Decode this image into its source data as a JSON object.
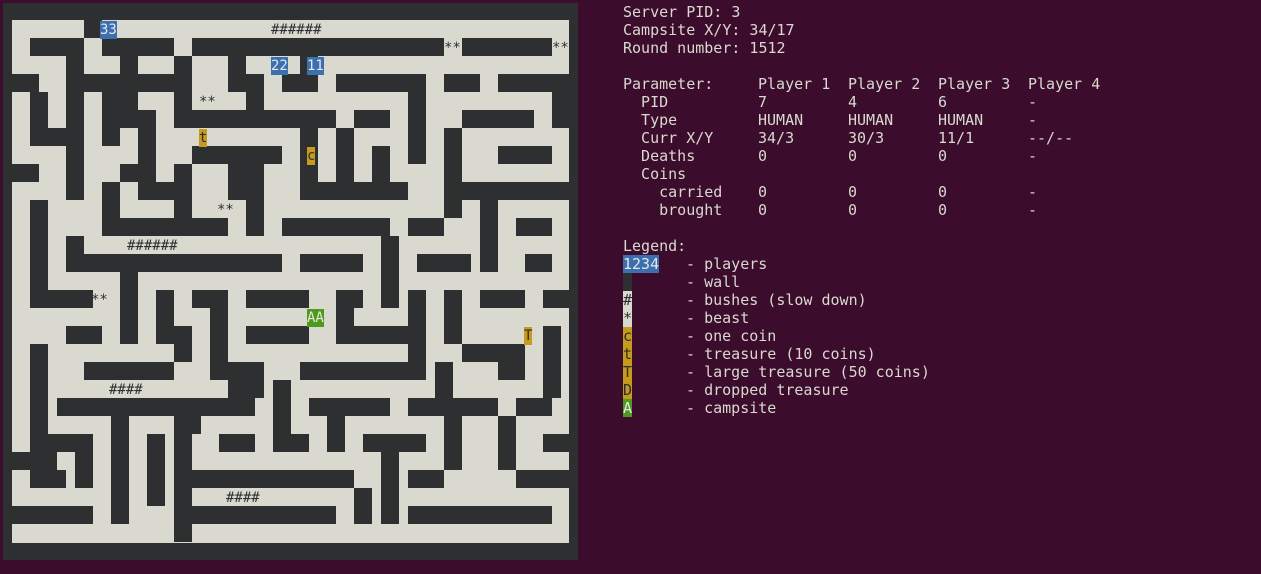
{
  "colors": {
    "background": "#3b0c2c",
    "wall": "#2d2f30",
    "floor": "#d9d9d0",
    "player": "#3b6fb0",
    "coin": "#c69a1a",
    "campsite": "#4f9a1d"
  },
  "header": {
    "server_pid": "Server PID: 3",
    "campsite_xy": "Campsite X/Y: 34/17",
    "round_number": "Round number: 1512"
  },
  "params": {
    "header": [
      "Parameter:",
      "Player 1",
      "Player 2",
      "Player 3",
      "Player 4"
    ],
    "rows": [
      {
        "label": "  PID",
        "values": [
          "7",
          "4",
          "6",
          "-"
        ]
      },
      {
        "label": "  Type",
        "values": [
          "HUMAN",
          "HUMAN",
          "HUMAN",
          "-"
        ]
      },
      {
        "label": "  Curr X/Y",
        "values": [
          "34/3",
          "30/3",
          "11/1",
          "--/--"
        ]
      },
      {
        "label": "  Deaths",
        "values": [
          "0",
          "0",
          "0",
          "-"
        ]
      },
      {
        "label": "  Coins",
        "values": [
          "",
          "",
          "",
          ""
        ]
      },
      {
        "label": "    carried",
        "values": [
          "0",
          "0",
          "0",
          "-"
        ]
      },
      {
        "label": "    brought",
        "values": [
          "0",
          "0",
          "0",
          "-"
        ]
      }
    ]
  },
  "legend": {
    "title": "Legend:",
    "items": [
      {
        "symbol": "1234",
        "kind": "players",
        "text": " - players"
      },
      {
        "symbol": " ",
        "kind": "wall",
        "text": " - wall"
      },
      {
        "symbol": "#",
        "kind": "bush",
        "text": " - bushes (slow down)"
      },
      {
        "symbol": "*",
        "kind": "beast",
        "text": " - beast"
      },
      {
        "symbol": "c",
        "kind": "coin",
        "text": " - one coin"
      },
      {
        "symbol": "t",
        "kind": "coin",
        "text": " - treasure (10 coins)"
      },
      {
        "symbol": "T",
        "kind": "coin",
        "text": " - large treasure (50 coins)"
      },
      {
        "symbol": "D",
        "kind": "coin",
        "text": " - dropped treasure"
      },
      {
        "symbol": "A",
        "kind": "camp",
        "text": " - campsite"
      }
    ]
  },
  "map": {
    "players": [
      "33",
      "22",
      "11"
    ],
    "campsite": "AA",
    "coins": [
      "t",
      "c",
      "T"
    ],
    "bushes": [
      "######",
      "######",
      "####",
      "####"
    ],
    "beasts": [
      "**",
      "**",
      "**",
      "**",
      "**",
      "**"
    ]
  }
}
